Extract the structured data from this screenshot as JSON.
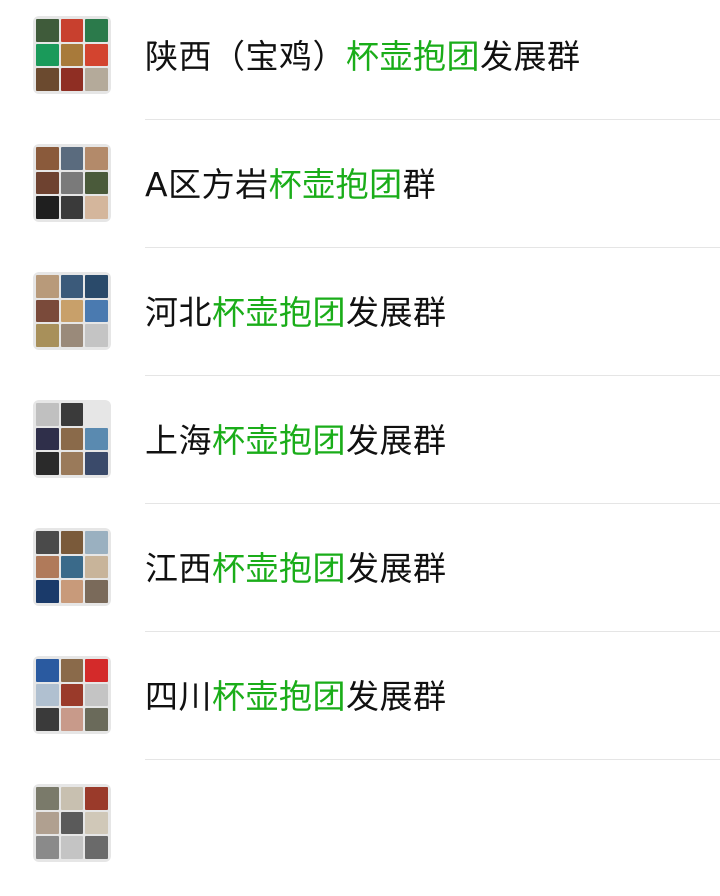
{
  "groups": [
    {
      "name": {
        "pre": "陕西（宝鸡）",
        "match": "杯壶抱团",
        "post": "发展群"
      },
      "avatar_colors": [
        "#3f5b3a",
        "#c8402e",
        "#2b7a4b",
        "#1a9a5a",
        "#a87a3a",
        "#d3442f",
        "#6b4a2f",
        "#8f2e23",
        "#b4aa9a"
      ]
    },
    {
      "name": {
        "pre": "A区方岩",
        "match": "杯壶抱团",
        "post": "群"
      },
      "avatar_colors": [
        "#8a5a3b",
        "#5a6b7e",
        "#b38a6a",
        "#6e4230",
        "#7a7a7a",
        "#4a5a3a",
        "#1f1f1f",
        "#3a3a3a",
        "#d4b69c"
      ]
    },
    {
      "name": {
        "pre": "河北",
        "match": "杯壶抱团",
        "post": "发展群"
      },
      "avatar_colors": [
        "#b89a7a",
        "#3b5a7a",
        "#2a4a6a",
        "#7a4a3a",
        "#c8a06a",
        "#4a7ab0",
        "#a8905a",
        "#9a8a7a",
        "#c4c4c4"
      ]
    },
    {
      "name": {
        "pre": "上海",
        "match": "杯壶抱团",
        "post": "发展群"
      },
      "avatar_colors": [
        "#c0c0c0",
        "#3a3a3a",
        "#e6e6e6",
        "#2f2f4a",
        "#8a6a4a",
        "#5a8ab0",
        "#2a2a2a",
        "#9a7a5a",
        "#3a4a6a"
      ]
    },
    {
      "name": {
        "pre": "江西",
        "match": "杯壶抱团",
        "post": "发展群"
      },
      "avatar_colors": [
        "#4a4a4a",
        "#7a5a3a",
        "#9ab0c0",
        "#b07a5a",
        "#3a6a8a",
        "#c8b49a",
        "#1a3a6a",
        "#c89a7a",
        "#7a6a5a"
      ]
    },
    {
      "name": {
        "pre": "四川",
        "match": "杯壶抱团",
        "post": "发展群"
      },
      "avatar_colors": [
        "#2a5aa0",
        "#8a6a4a",
        "#d42a2a",
        "#b0c0d0",
        "#9a3a2a",
        "#c4c4c4",
        "#3a3a3a",
        "#c89a8a",
        "#6a6a5a"
      ]
    },
    {
      "name": {
        "pre": "",
        "match": "",
        "post": ""
      },
      "avatar_colors": [
        "#7a7a6a",
        "#c8c0b0",
        "#9a3a2a",
        "#b0a090",
        "#5a5a5a",
        "#d0c8b8",
        "#8a8a8a",
        "#c4c4c4",
        "#6a6a6a"
      ]
    }
  ]
}
